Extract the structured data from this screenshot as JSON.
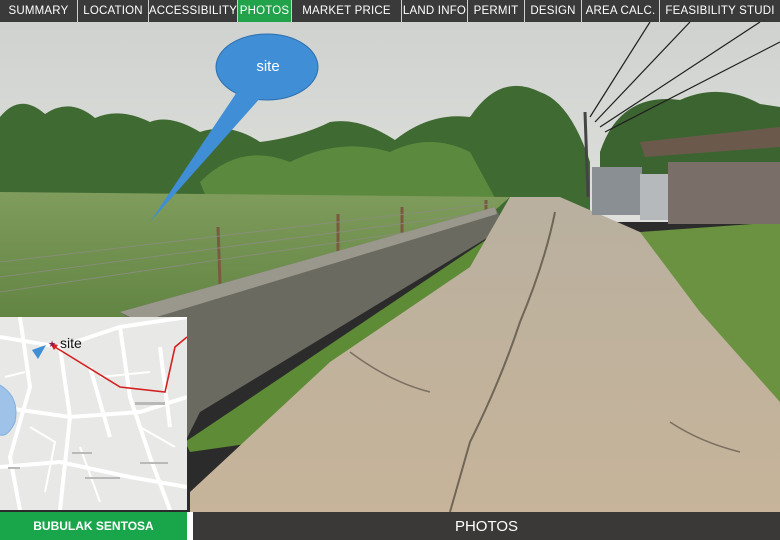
{
  "nav": {
    "tabs": [
      {
        "label": "SUMMARY"
      },
      {
        "label": "LOCATION"
      },
      {
        "label": "ACCESSIBILITY"
      },
      {
        "label": "PHOTOS",
        "active": true
      },
      {
        "label": "MARKET PRICE"
      },
      {
        "label": "LAND INFO"
      },
      {
        "label": "PERMIT"
      },
      {
        "label": "DESIGN"
      },
      {
        "label": "AREA CALC."
      },
      {
        "label": "FEASIBILITY  STUDI"
      }
    ]
  },
  "photo": {
    "callout_label": "site"
  },
  "inset_map": {
    "site_label": "site",
    "pin_icon": "star-marker-icon",
    "direction_icon": "direction-triangle-icon"
  },
  "footer": {
    "location_name": "BUBULAK SENTOSA",
    "section_title": "PHOTOS"
  },
  "colors": {
    "active_tab": "#22a24a",
    "location_badge": "#19a64a",
    "tab_bar": "#3a3a3a",
    "callout": "#3f8ed6",
    "route": "#d42020"
  }
}
